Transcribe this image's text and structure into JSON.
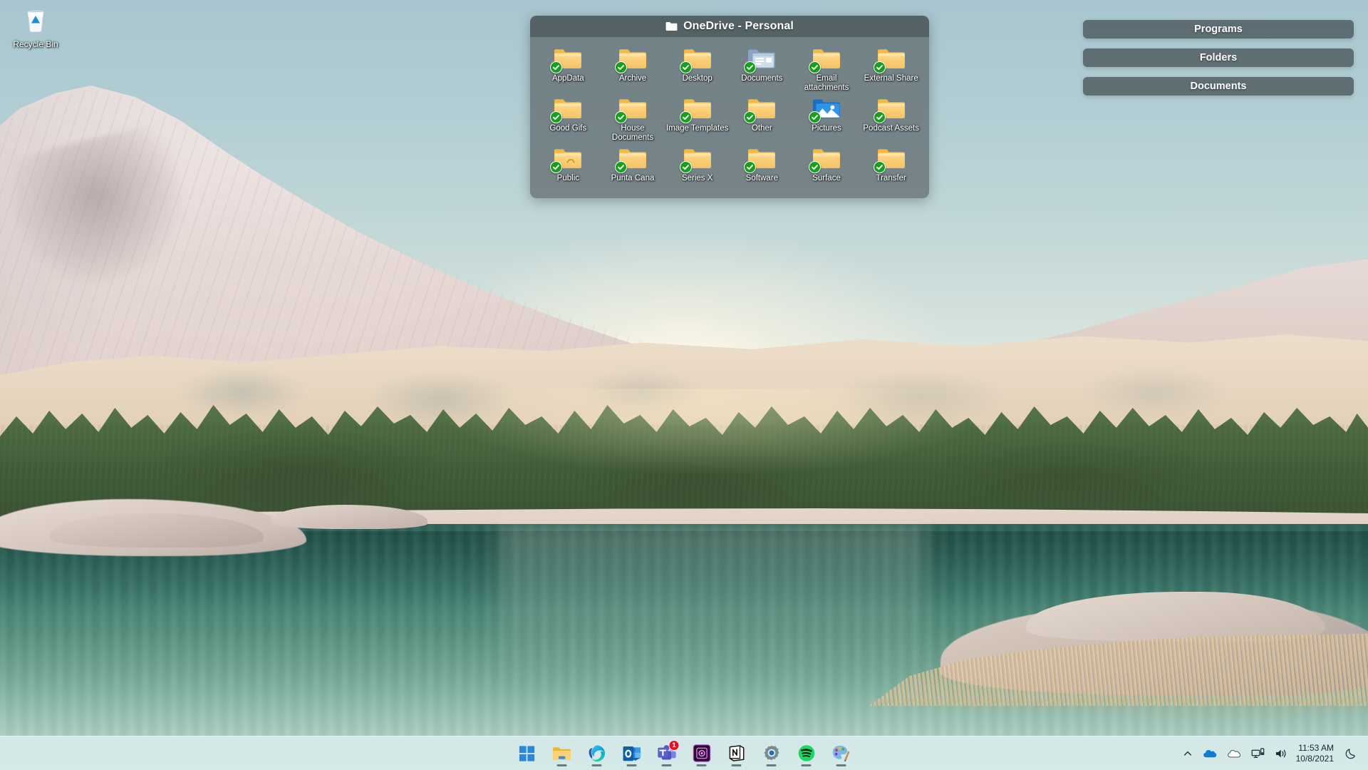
{
  "desktop": {
    "icons": [
      {
        "name": "Recycle Bin",
        "icon": "recycle-bin-icon"
      }
    ]
  },
  "fence_window": {
    "title": "OneDrive - Personal",
    "title_icon": "folder-icon",
    "rows": [
      [
        {
          "label": "AppData",
          "icon": "folder-icon",
          "sync": "synced",
          "shared": false
        },
        {
          "label": "Archive",
          "icon": "folder-icon",
          "sync": "synced",
          "shared": false
        },
        {
          "label": "Desktop",
          "icon": "folder-icon",
          "sync": "synced",
          "shared": false
        },
        {
          "label": "Documents",
          "icon": "documents-folder-icon",
          "sync": "synced",
          "shared": false
        },
        {
          "label": "Email attachments",
          "icon": "folder-icon",
          "sync": "synced",
          "shared": false
        },
        {
          "label": "External Share",
          "icon": "folder-icon",
          "sync": "synced",
          "shared": false
        }
      ],
      [
        {
          "label": "Good Gifs",
          "icon": "folder-icon",
          "sync": "synced",
          "shared": false
        },
        {
          "label": "House Documents",
          "icon": "folder-icon",
          "sync": "synced",
          "shared": false
        },
        {
          "label": "Image Templates",
          "icon": "folder-icon",
          "sync": "synced",
          "shared": false
        },
        {
          "label": "Other",
          "icon": "folder-icon",
          "sync": "synced",
          "shared": false
        },
        {
          "label": "Pictures",
          "icon": "pictures-folder-icon",
          "sync": "synced",
          "shared": false
        },
        {
          "label": "Podcast Assets",
          "icon": "folder-icon",
          "sync": "synced",
          "shared": false
        }
      ],
      [
        {
          "label": "Public",
          "icon": "folder-icon",
          "sync": "synced",
          "shared": true
        },
        {
          "label": "Punta Cana",
          "icon": "folder-icon",
          "sync": "synced",
          "shared": false
        },
        {
          "label": "Series X",
          "icon": "folder-icon",
          "sync": "synced",
          "shared": false
        },
        {
          "label": "Software",
          "icon": "folder-icon",
          "sync": "synced",
          "shared": false
        },
        {
          "label": "Surface",
          "icon": "folder-icon",
          "sync": "synced",
          "shared": false
        },
        {
          "label": "Transfer",
          "icon": "folder-icon",
          "sync": "synced",
          "shared": false
        }
      ]
    ]
  },
  "side_fences": [
    {
      "label": "Programs"
    },
    {
      "label": "Folders"
    },
    {
      "label": "Documents"
    }
  ],
  "taskbar": {
    "apps": [
      {
        "name": "start-button",
        "label": "Start",
        "running": false,
        "badge": null
      },
      {
        "name": "file-explorer-button",
        "label": "File Explorer",
        "running": true,
        "badge": null
      },
      {
        "name": "edge-button",
        "label": "Microsoft Edge",
        "running": true,
        "badge": null
      },
      {
        "name": "outlook-button",
        "label": "Outlook",
        "running": true,
        "badge": null
      },
      {
        "name": "teams-button",
        "label": "Microsoft Teams",
        "running": true,
        "badge": "1"
      },
      {
        "name": "adobe-button",
        "label": "Adobe",
        "running": true,
        "badge": null
      },
      {
        "name": "notion-button",
        "label": "Notion",
        "running": true,
        "badge": null
      },
      {
        "name": "settings-button",
        "label": "Settings",
        "running": true,
        "badge": null
      },
      {
        "name": "spotify-button",
        "label": "Spotify",
        "running": true,
        "badge": null
      },
      {
        "name": "paint-button",
        "label": "Paint",
        "running": true,
        "badge": null
      }
    ],
    "tray": {
      "overflow_icon": "chevron-up-icon",
      "onedrive_personal_icon": "cloud-blue-icon",
      "onedrive_work_icon": "cloud-grey-icon",
      "network_icon": "network-icon",
      "volume_icon": "speaker-icon",
      "time": "11:53 AM",
      "date": "10/8/2021",
      "notifications_icon": "moon-icon"
    }
  },
  "colors": {
    "fence_bg": "#657074",
    "fence_titlebar": "#4b585d",
    "fence_button": "#525e63",
    "sync_green": "#17a01c",
    "badge_red": "#e81123",
    "taskbar_bg": "#d8ebec"
  }
}
